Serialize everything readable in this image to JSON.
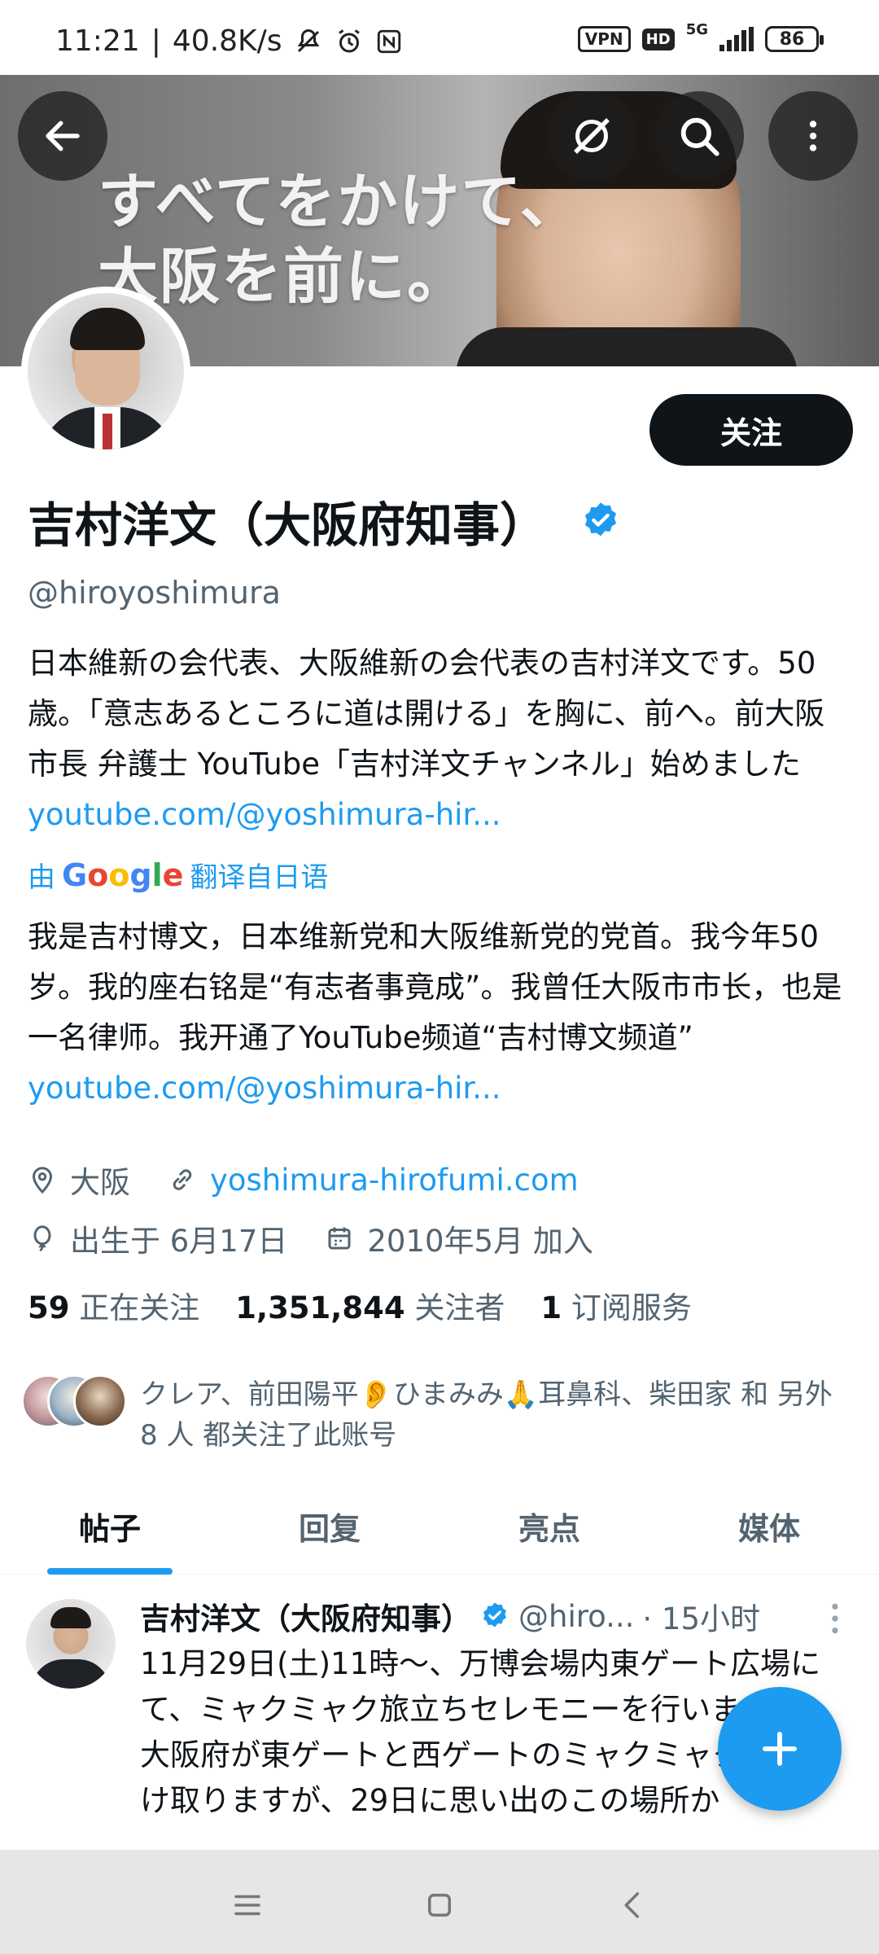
{
  "status_bar": {
    "time": "11:21",
    "speed": "40.8K/s",
    "vpn": "VPN",
    "hd": "HD",
    "network": "5G",
    "battery": "86"
  },
  "banner": {
    "line1": "すべてをかけて、",
    "line2": "大阪を前に。"
  },
  "profile": {
    "follow_label": "关注",
    "name": "吉村洋文（大阪府知事）",
    "handle": "@hiroyoshimura",
    "bio_text": "日本維新の会代表、大阪維新の会代表の吉村洋文です。50歳。「意志あるところに道は開ける」を胸に、前へ。前大阪市長 弁護士 YouTube「吉村洋文チャンネル」始めました",
    "bio_link": "youtube.com/@yoshimura-hir...",
    "translate_prefix": "由",
    "translate_suffix": "翻译自日语",
    "bio_translated_text": "我是吉村博文，日本维新党和大阪维新党的党首。我今年50岁。我的座右铭是“有志者事竟成”。我曾任大阪市市长，也是一名律师。我开通了YouTube频道“吉村博文频道” ",
    "bio_translated_link": "youtube.com/@yoshimura-hir...",
    "location": "大阪",
    "website": "yoshimura-hirofumi.com",
    "birthday": "出生于 6月17日",
    "joined": "2010年5月 加入",
    "following_count": "59",
    "following_label": "正在关注",
    "followers_count": "1,351,844",
    "followers_label": "关注者",
    "subscriptions_count": "1",
    "subscriptions_label": "订阅服务",
    "followed_by": "クレア、前田陽平👂ひまみみ🙏耳鼻科、柴田家 和 另外 8 人 都关注了此账号"
  },
  "tabs": [
    {
      "label": "帖子"
    },
    {
      "label": "回复"
    },
    {
      "label": "亮点"
    },
    {
      "label": "媒体"
    }
  ],
  "post": {
    "author": "吉村洋文（大阪府知事）",
    "handle": "@hiro...",
    "time": "· 15小时",
    "body": "11月29日(土)11時〜、万博会場内東ゲート広場にて、ミャクミャク旅立ちセレモニーを行います。\n大阪府が東ゲートと西ゲートのミャクミャク像を受け取りますが、29日に思い出のこの場所か"
  },
  "colors": {
    "accent": "#1d9bf0",
    "text": "#0f1419",
    "secondary": "#536471"
  }
}
